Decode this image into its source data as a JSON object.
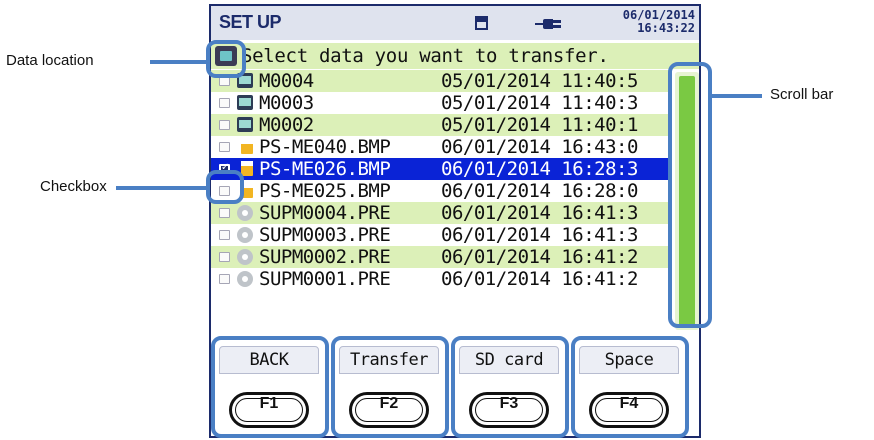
{
  "status_bar": {
    "title": "SET UP",
    "date": "06/01/2014",
    "time": "16:43:22",
    "card_icon": "memory-card-icon",
    "power_icon": "power-plug-icon"
  },
  "header": {
    "location_icon": "data-location-icon",
    "prompt": "Select data you want to transfer."
  },
  "files": [
    {
      "name": "M0004",
      "date": "05/01/2014 11:40:5",
      "type": "measurement",
      "checked": false,
      "selected": false
    },
    {
      "name": "M0003",
      "date": "05/01/2014 11:40:3",
      "type": "measurement",
      "checked": false,
      "selected": false
    },
    {
      "name": "M0002",
      "date": "05/01/2014 11:40:1",
      "type": "measurement",
      "checked": false,
      "selected": false
    },
    {
      "name": "PS-ME040.BMP",
      "date": "06/01/2014 16:43:0",
      "type": "bitmap",
      "checked": false,
      "selected": false
    },
    {
      "name": "PS-ME026.BMP",
      "date": "06/01/2014 16:28:3",
      "type": "bitmap",
      "checked": true,
      "selected": true
    },
    {
      "name": "PS-ME025.BMP",
      "date": "06/01/2014 16:28:0",
      "type": "bitmap",
      "checked": false,
      "selected": false
    },
    {
      "name": "SUPM0004.PRE",
      "date": "06/01/2014 16:41:3",
      "type": "preset",
      "checked": false,
      "selected": false
    },
    {
      "name": "SUPM0003.PRE",
      "date": "06/01/2014 16:41:3",
      "type": "preset",
      "checked": false,
      "selected": false
    },
    {
      "name": "SUPM0002.PRE",
      "date": "06/01/2014 16:41:2",
      "type": "preset",
      "checked": false,
      "selected": false
    },
    {
      "name": "SUPM0001.PRE",
      "date": "06/01/2014 16:41:2",
      "type": "preset",
      "checked": false,
      "selected": false
    }
  ],
  "function_keys": [
    {
      "label": "BACK",
      "key": "F1"
    },
    {
      "label": "Transfer",
      "key": "F2"
    },
    {
      "label": "SD card",
      "key": "F3"
    },
    {
      "label": "Space",
      "key": "F4"
    }
  ],
  "callouts": {
    "data_location": "Data  location",
    "checkbox": "Checkbox",
    "scroll_bar": "Scroll bar"
  },
  "colors": {
    "accent_blue": "#1c2b6b",
    "selection_blue": "#0a23d6",
    "row_green": "#dcf0b8",
    "scroll_green": "#7ac943",
    "callout_blue": "#4a7fc4"
  }
}
